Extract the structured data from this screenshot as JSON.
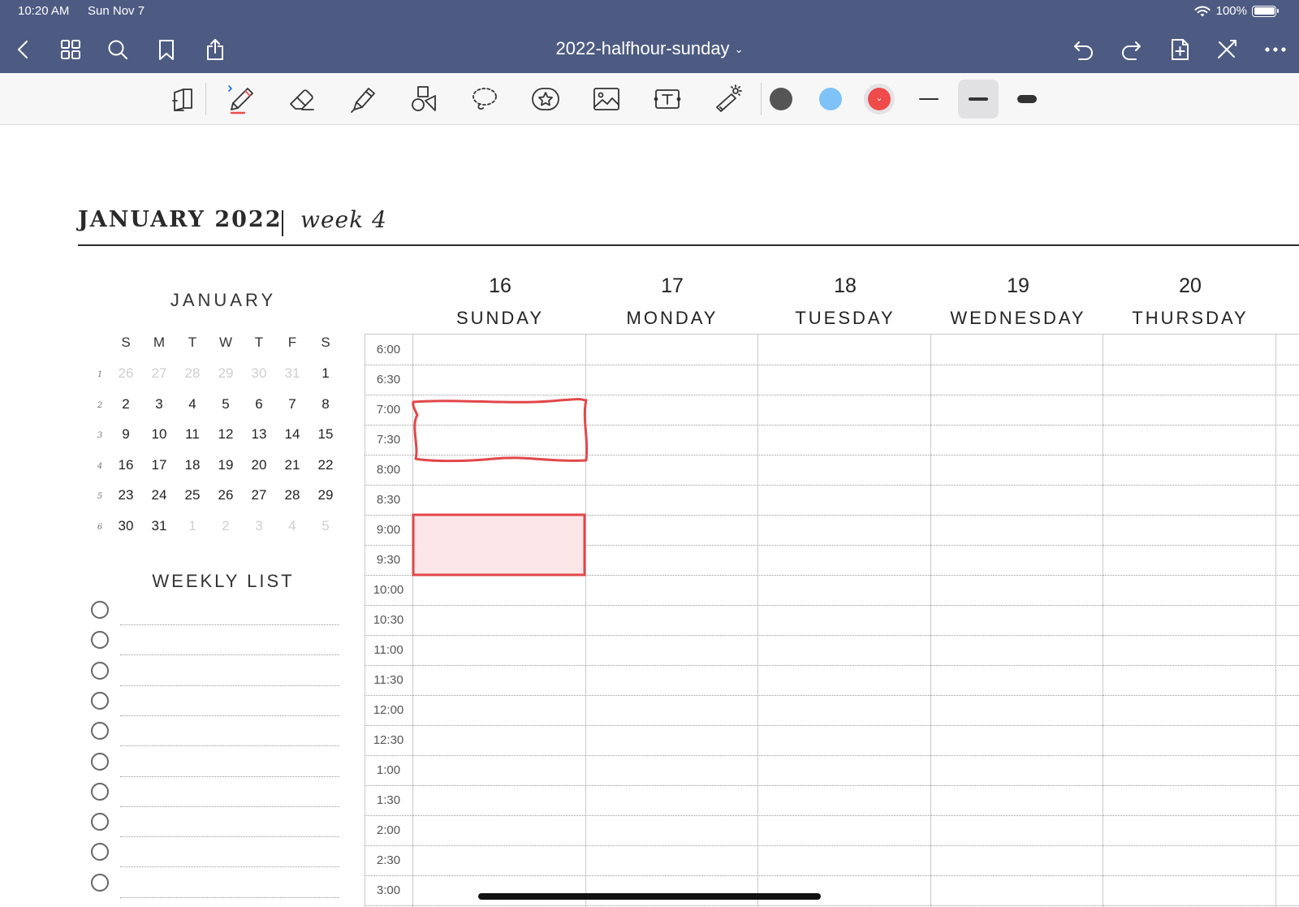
{
  "status_bar": {
    "time": "10:20 AM",
    "date": "Sun Nov 7",
    "battery": "100%"
  },
  "nav": {
    "title": "2022-halfhour-sunday",
    "title_chevron": "⌄",
    "icons": [
      "back-icon",
      "grid-icon",
      "search-icon",
      "bookmark-icon",
      "share-icon",
      "undo-icon",
      "redo-icon",
      "add-page-icon",
      "close-toolbar-icon",
      "more-icon"
    ]
  },
  "toolbar": {
    "tools": [
      "read-mode-icon",
      "pen-icon",
      "eraser-icon",
      "highlighter-icon",
      "shapes-icon",
      "lasso-icon",
      "sticker-icon",
      "image-icon",
      "text-icon",
      "laser-pointer-icon"
    ],
    "colors": {
      "dark_gray": "#555555",
      "light_blue": "#7ec2f8",
      "red": "#ef4b4b"
    },
    "selected_color": "red",
    "selected_stroke": "medium"
  },
  "page": {
    "month_title": "JANUARY 2022",
    "week_title": "week 4"
  },
  "mini_calendar": {
    "title": "JANUARY",
    "weekdays": [
      "S",
      "M",
      "T",
      "W",
      "T",
      "F",
      "S"
    ],
    "weeks": [
      {
        "num": "1",
        "days": [
          "26",
          "27",
          "28",
          "29",
          "30",
          "31",
          "1"
        ],
        "faded": [
          true,
          true,
          true,
          true,
          true,
          true,
          false
        ]
      },
      {
        "num": "2",
        "days": [
          "2",
          "3",
          "4",
          "5",
          "6",
          "7",
          "8"
        ],
        "faded": [
          false,
          false,
          false,
          false,
          false,
          false,
          false
        ]
      },
      {
        "num": "3",
        "days": [
          "9",
          "10",
          "11",
          "12",
          "13",
          "14",
          "15"
        ],
        "faded": [
          false,
          false,
          false,
          false,
          false,
          false,
          false
        ]
      },
      {
        "num": "4",
        "days": [
          "16",
          "17",
          "18",
          "19",
          "20",
          "21",
          "22"
        ],
        "faded": [
          false,
          false,
          false,
          false,
          false,
          false,
          false
        ]
      },
      {
        "num": "5",
        "days": [
          "23",
          "24",
          "25",
          "26",
          "27",
          "28",
          "29"
        ],
        "faded": [
          false,
          false,
          false,
          false,
          false,
          false,
          false
        ]
      },
      {
        "num": "6",
        "days": [
          "30",
          "31",
          "1",
          "2",
          "3",
          "4",
          "5"
        ],
        "faded": [
          false,
          false,
          true,
          true,
          true,
          true,
          true
        ]
      }
    ]
  },
  "weekly_list": {
    "title": "WEEKLY LIST",
    "item_count": 10
  },
  "week_grid": {
    "days": [
      {
        "num": "16",
        "name": "SUNDAY"
      },
      {
        "num": "17",
        "name": "MONDAY"
      },
      {
        "num": "18",
        "name": "TUESDAY"
      },
      {
        "num": "19",
        "name": "WEDNESDAY"
      },
      {
        "num": "20",
        "name": "THURSDAY"
      }
    ],
    "times": [
      "6:00",
      "6:30",
      "7:00",
      "7:30",
      "8:00",
      "8:30",
      "9:00",
      "9:30",
      "10:00",
      "10:30",
      "11:00",
      "11:30",
      "12:00",
      "12:30",
      "1:00",
      "1:30",
      "2:00",
      "2:30",
      "3:00"
    ]
  },
  "annotations": {
    "color": "#e2474a",
    "fill_color": "#fde6e8",
    "items": [
      {
        "type": "hand-drawn-box",
        "day": "16",
        "start": "7:00",
        "end": "8:00"
      },
      {
        "type": "filled-box",
        "day": "16",
        "start": "9:00",
        "end": "10:00"
      }
    ]
  }
}
